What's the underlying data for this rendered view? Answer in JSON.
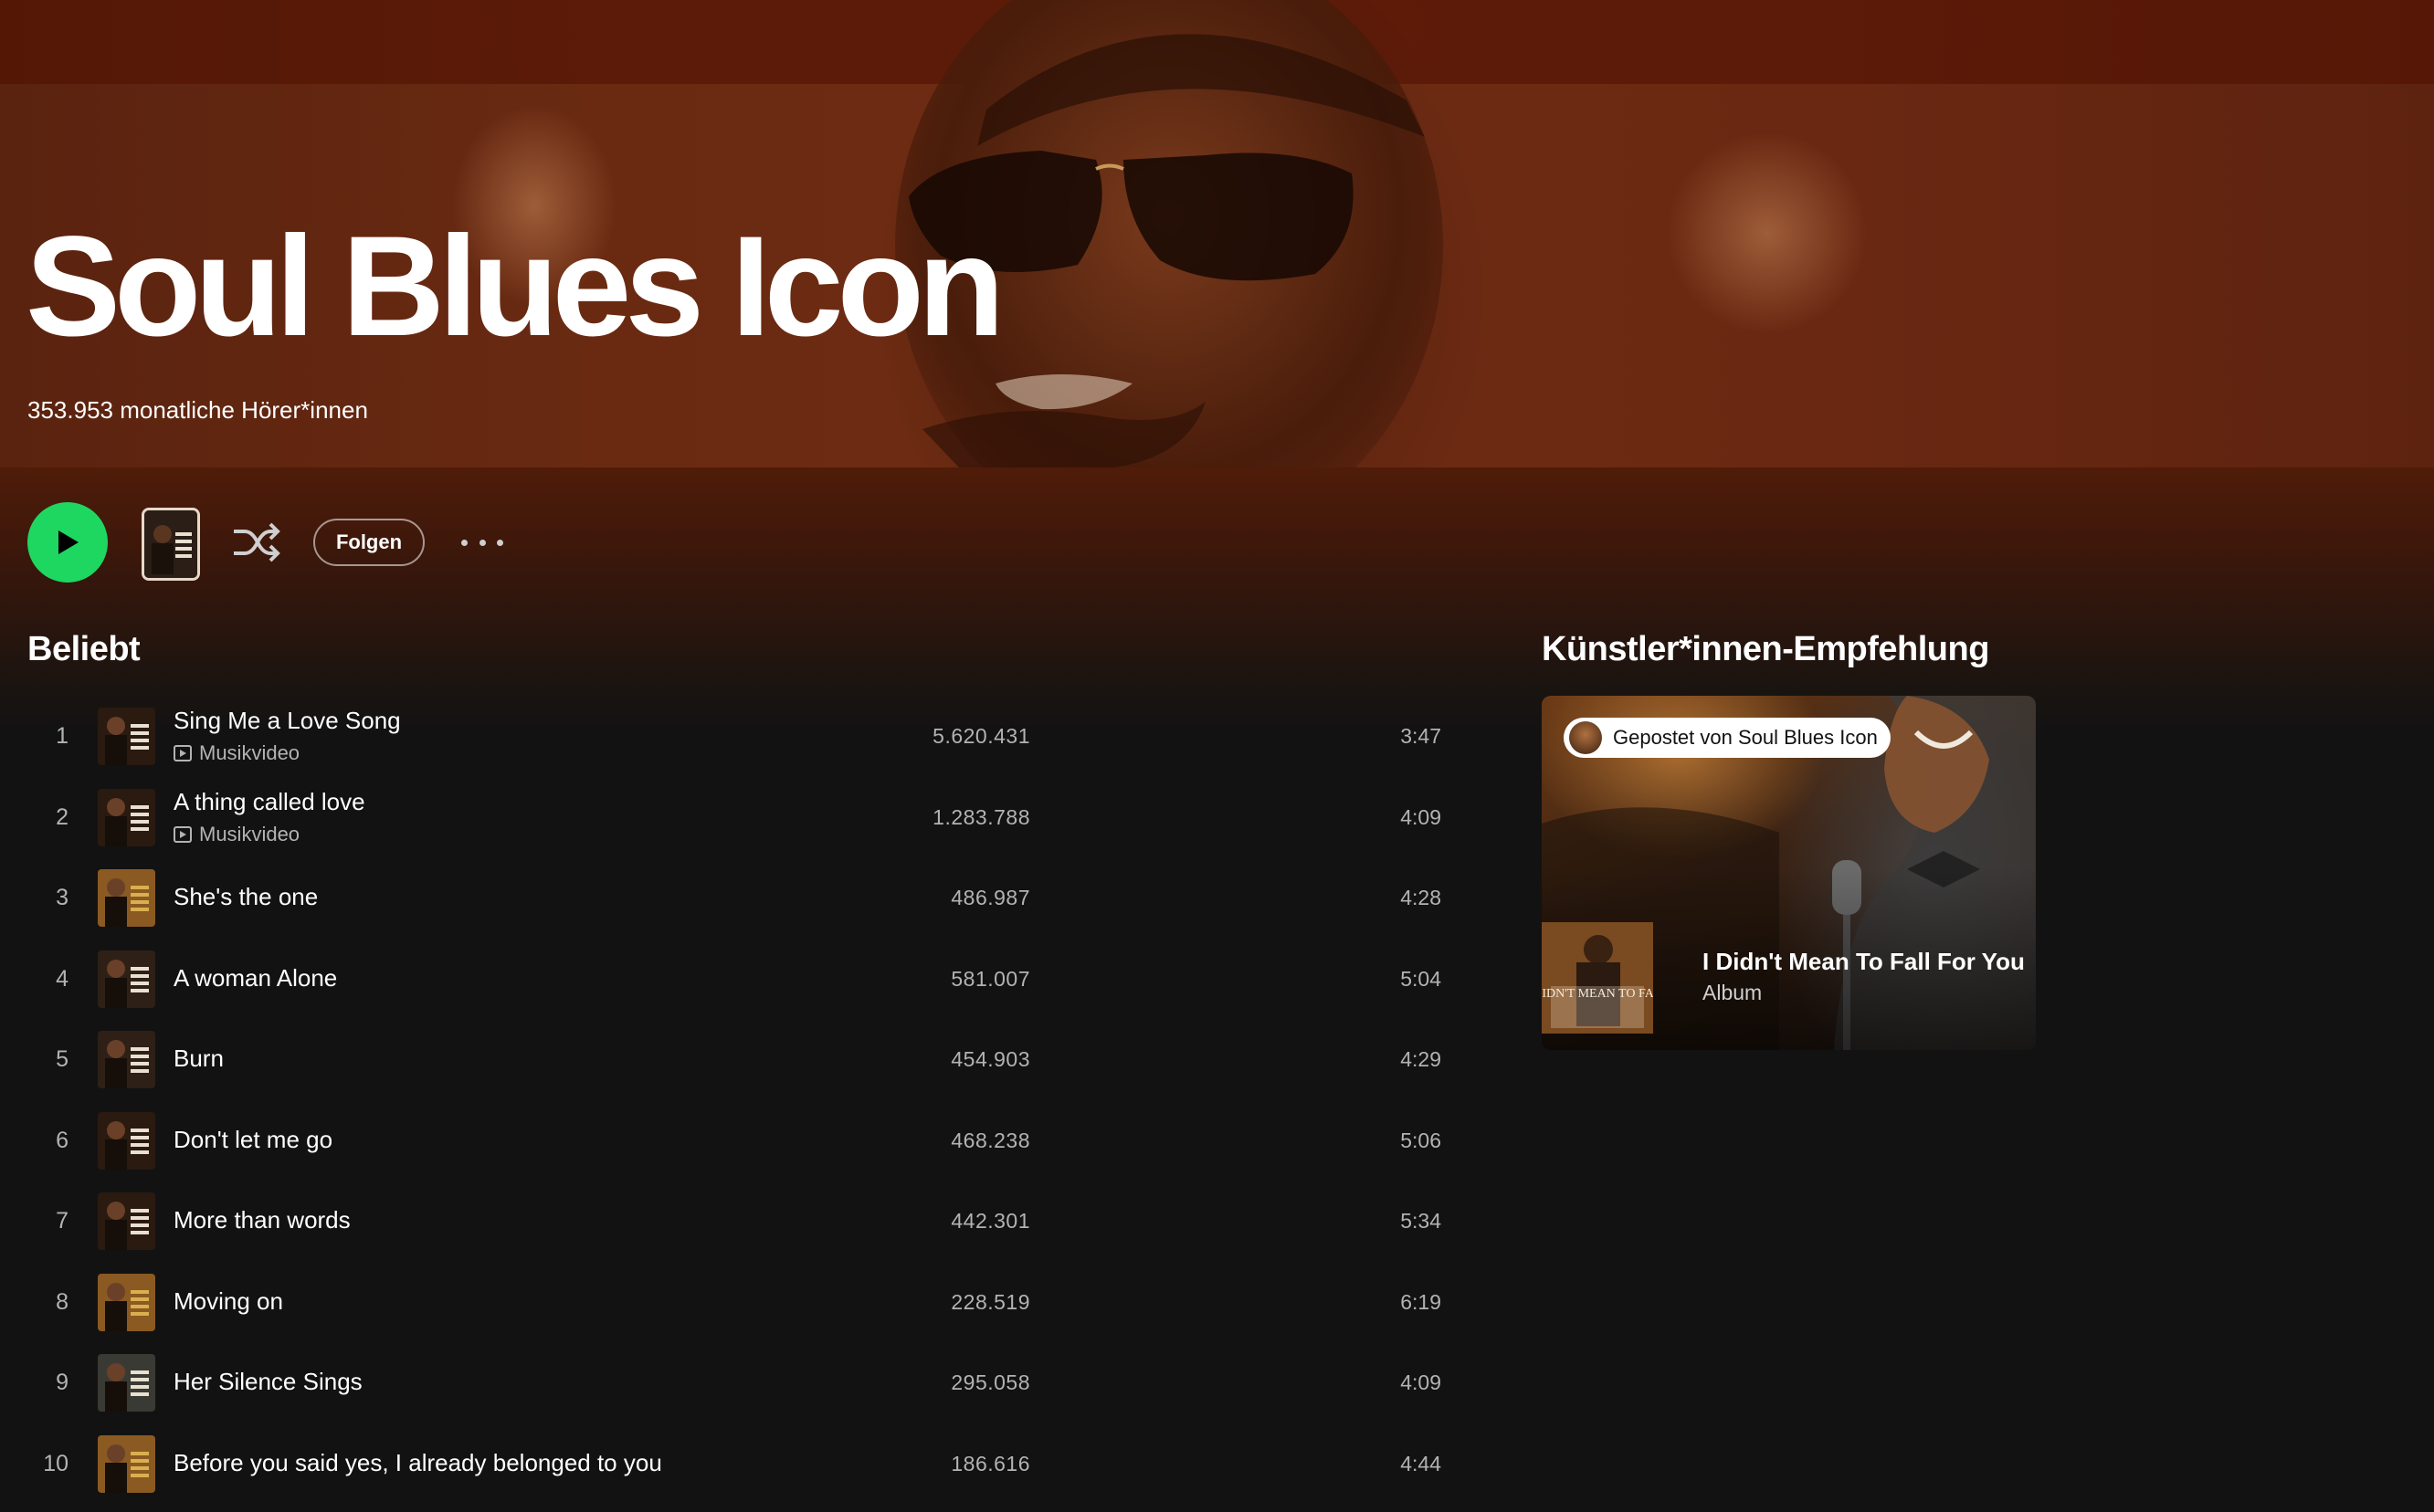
{
  "colors": {
    "accent_green": "#1ed760",
    "background": "#121212",
    "hero_brown": "#6a2a12",
    "muted_text": "#b3b3b3"
  },
  "artist": {
    "name": "Soul Blues Icon",
    "monthly_listeners": "353.953 monatliche Hörer*innen"
  },
  "actions": {
    "play_icon": "play-icon",
    "shuffle_icon": "shuffle-icon",
    "follow_label": "Folgen",
    "more_icon": "more-options-icon"
  },
  "popular": {
    "title": "Beliebt",
    "tracks": [
      {
        "number": "1",
        "title": "Sing Me a Love Song",
        "subtitle": "Musikvideo",
        "plays": "5.620.431",
        "duration": "3:47"
      },
      {
        "number": "2",
        "title": "A thing called love",
        "subtitle": "Musikvideo",
        "plays": "1.283.788",
        "duration": "4:09"
      },
      {
        "number": "3",
        "title": "She's the one",
        "plays": "486.987",
        "duration": "4:28"
      },
      {
        "number": "4",
        "title": "A woman Alone",
        "plays": "581.007",
        "duration": "5:04"
      },
      {
        "number": "5",
        "title": "Burn",
        "plays": "454.903",
        "duration": "4:29"
      },
      {
        "number": "6",
        "title": "Don't let me go",
        "plays": "468.238",
        "duration": "5:06"
      },
      {
        "number": "7",
        "title": "More than words",
        "plays": "442.301",
        "duration": "5:34"
      },
      {
        "number": "8",
        "title": "Moving on",
        "plays": "228.519",
        "duration": "6:19"
      },
      {
        "number": "9",
        "title": "Her Silence Sings",
        "plays": "295.058",
        "duration": "4:09"
      },
      {
        "number": "10",
        "title": "Before you said yes, I already belonged to you",
        "plays": "186.616",
        "duration": "4:44"
      }
    ]
  },
  "recommendation": {
    "title": "Künstler*innen-Empfehlung",
    "posted_by": "Gepostet von Soul Blues Icon",
    "album_title": "I Didn't Mean To Fall For You",
    "album_type": "Album",
    "cover_text": "I DIDN'T MEAN TO FALL"
  }
}
